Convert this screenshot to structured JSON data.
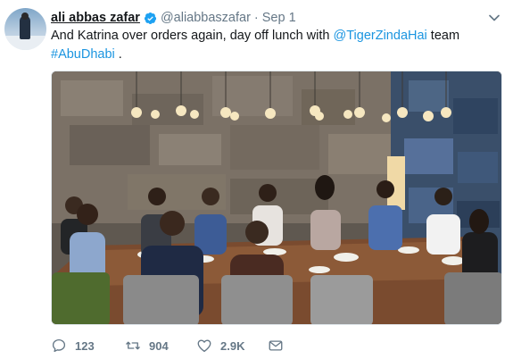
{
  "tweet": {
    "author_name": "ali abbas zafar",
    "author_handle": "@aliabbaszafar",
    "separator": "·",
    "date": "Sep 1",
    "text_part1": "And Katrina over orders again, day off lunch with ",
    "mention": "@TigerZindaHai",
    "text_part2": " team",
    "hashtag": "#AbuDhabi",
    "text_end": " ."
  },
  "icons": {
    "avatar": "profile-photo",
    "verified": "verified-badge-icon",
    "menu": "chevron-down-icon",
    "reply": "reply-icon",
    "retweet": "retweet-icon",
    "like": "heart-icon",
    "message": "direct-message-icon"
  },
  "actions": {
    "reply_count": "123",
    "retweet_count": "904",
    "like_count": "2.9K"
  },
  "colors": {
    "link": "#1b95e0",
    "secondary_text": "#657786",
    "verified": "#1da1f2"
  }
}
